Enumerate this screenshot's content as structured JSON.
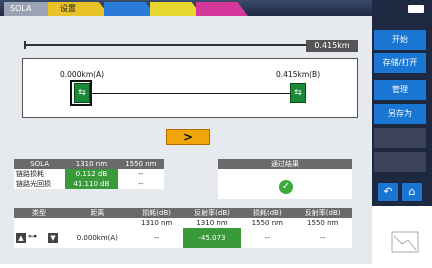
{
  "tabs": {
    "sola": "SOLA",
    "settings": "设置"
  },
  "colors": {
    "tab_yellow": "#e7c229",
    "accent_blue": "#1976d2",
    "pass_green": "#3a9a3a",
    "next_orange": "#f2a50a"
  },
  "top_ruler": {
    "total_distance": "0.415km"
  },
  "link_map": {
    "point_a_label": "0.000km(A)",
    "point_b_label": "0.415km(B)",
    "next_icon": "chevron-right-icon"
  },
  "summary_table": {
    "headers": [
      "SOLA",
      "1310 nm",
      "1550 nm"
    ],
    "rows": [
      {
        "label": "链路损耗",
        "v1310": "0.112 dB",
        "v1550": "--"
      },
      {
        "label": "链路光回损",
        "v1310": "41.110 dB",
        "v1550": "--"
      }
    ]
  },
  "result": {
    "title": "通过结果",
    "icon": "check-circle-icon"
  },
  "event_table": {
    "headers": [
      "类型",
      "距离",
      "损耗(dB)",
      "反射率(dB)",
      "损耗(dB)",
      "反射率(dB)"
    ],
    "sub_headers": [
      "",
      "",
      "1310 nm",
      "1310 nm",
      "1550 nm",
      "1550 nm"
    ],
    "row": {
      "distance": "0.000km(A)",
      "loss1310": "--",
      "refl1310": "-45.073",
      "loss1550": "--",
      "refl1550": "--"
    }
  },
  "side_menu": {
    "start": "开始",
    "save_open": "存储/打开",
    "manage": "管理",
    "save_as": "另存为"
  }
}
